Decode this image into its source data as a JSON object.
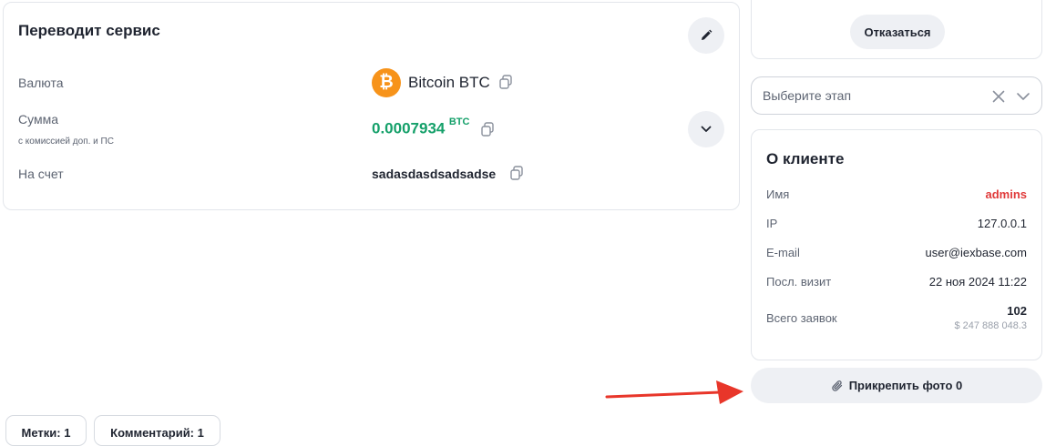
{
  "service_card": {
    "title": "Переводит сервис",
    "currency_label": "Валюта",
    "currency_value": "Bitcoin BTC",
    "amount_label": "Сумма",
    "amount_sublabel": "с комиссией доп. и ПС",
    "amount_value": "0.0007934",
    "amount_unit": "BTC",
    "account_label": "На счет",
    "account_value": "sadasdasdsadsadse"
  },
  "refuse_button": "Отказаться",
  "stage_select": {
    "placeholder": "Выберите этап"
  },
  "client_card": {
    "title": "О клиенте",
    "rows": [
      {
        "label": "Имя",
        "value": "admins"
      },
      {
        "label": "IP",
        "value": "127.0.0.1"
      },
      {
        "label": "E-mail",
        "value": "user@iexbase.com"
      },
      {
        "label": "Посл. визит",
        "value": "22 ноя 2024 11:22"
      }
    ],
    "orders_label": "Всего заявок",
    "orders_count": "102",
    "orders_sum": "$ 247 888 048.3"
  },
  "attach_button": "Прикрепить фото 0",
  "tabs": [
    {
      "label": "Метки: 1"
    },
    {
      "label": "Комментарий: 1"
    }
  ],
  "colors": {
    "accent_green": "#15a06a",
    "name_red": "#e03a3a",
    "arrow_red": "#e8362a",
    "btc_orange": "#f7931a"
  }
}
